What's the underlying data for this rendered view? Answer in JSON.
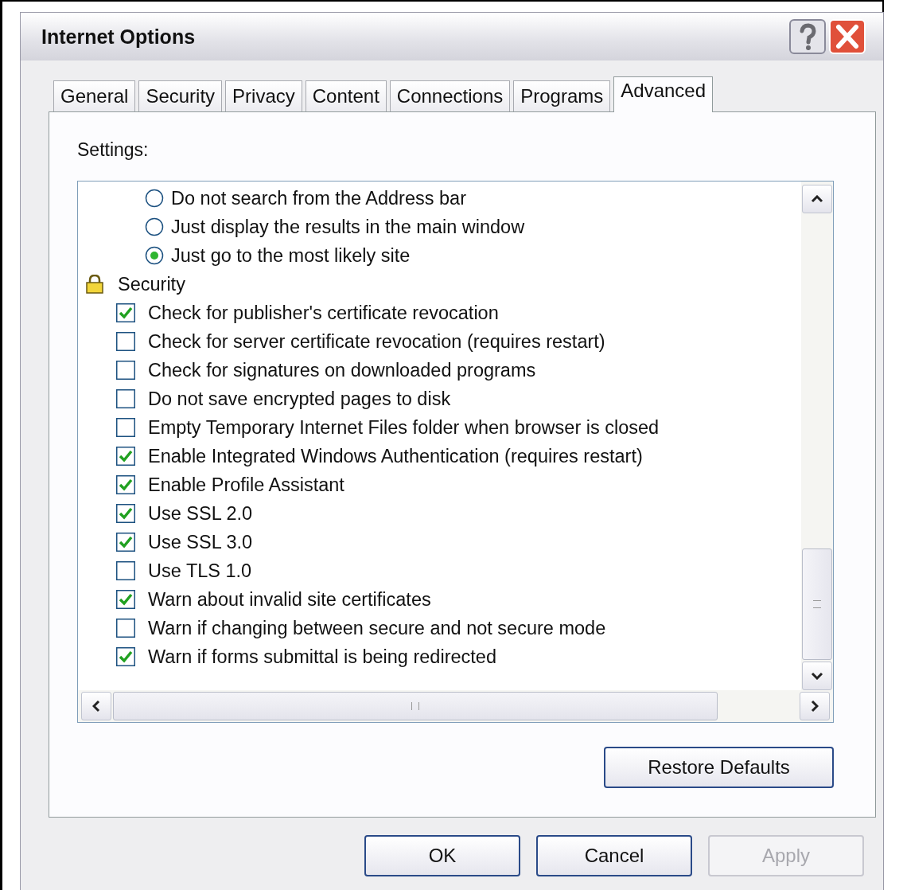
{
  "window": {
    "title": "Internet Options"
  },
  "tabs": [
    {
      "label": "General",
      "selected": false
    },
    {
      "label": "Security",
      "selected": false
    },
    {
      "label": "Privacy",
      "selected": false
    },
    {
      "label": "Content",
      "selected": false
    },
    {
      "label": "Connections",
      "selected": false
    },
    {
      "label": "Programs",
      "selected": false
    },
    {
      "label": "Advanced",
      "selected": true
    }
  ],
  "settings_label": "Settings:",
  "settings": [
    {
      "kind": "radio",
      "label": "Do not search from the Address bar",
      "selected": false
    },
    {
      "kind": "radio",
      "label": "Just display the results in the main window",
      "selected": false
    },
    {
      "kind": "radio",
      "label": "Just go to the most likely site",
      "selected": true
    },
    {
      "kind": "group",
      "label": "Security",
      "children": [
        {
          "kind": "checkbox",
          "label": "Check for publisher's certificate revocation",
          "checked": true
        },
        {
          "kind": "checkbox",
          "label": "Check for server certificate revocation (requires restart)",
          "checked": false
        },
        {
          "kind": "checkbox",
          "label": "Check for signatures on downloaded programs",
          "checked": false
        },
        {
          "kind": "checkbox",
          "label": "Do not save encrypted pages to disk",
          "checked": false
        },
        {
          "kind": "checkbox",
          "label": "Empty Temporary Internet Files folder when browser is closed",
          "checked": false
        },
        {
          "kind": "checkbox",
          "label": "Enable Integrated Windows Authentication (requires restart)",
          "checked": true
        },
        {
          "kind": "checkbox",
          "label": "Enable Profile Assistant",
          "checked": true
        },
        {
          "kind": "checkbox",
          "label": "Use SSL 2.0",
          "checked": true
        },
        {
          "kind": "checkbox",
          "label": "Use SSL 3.0",
          "checked": true
        },
        {
          "kind": "checkbox",
          "label": "Use TLS 1.0",
          "checked": false
        },
        {
          "kind": "checkbox",
          "label": "Warn about invalid site certificates",
          "checked": true
        },
        {
          "kind": "checkbox",
          "label": "Warn if changing between secure and not secure mode",
          "checked": false
        },
        {
          "kind": "checkbox",
          "label": "Warn if forms submittal is being redirected",
          "checked": true
        }
      ]
    }
  ],
  "restore_button": "Restore Defaults",
  "buttons": [
    {
      "label": "OK",
      "disabled": false
    },
    {
      "label": "Cancel",
      "disabled": false
    },
    {
      "label": "Apply",
      "disabled": true
    }
  ]
}
